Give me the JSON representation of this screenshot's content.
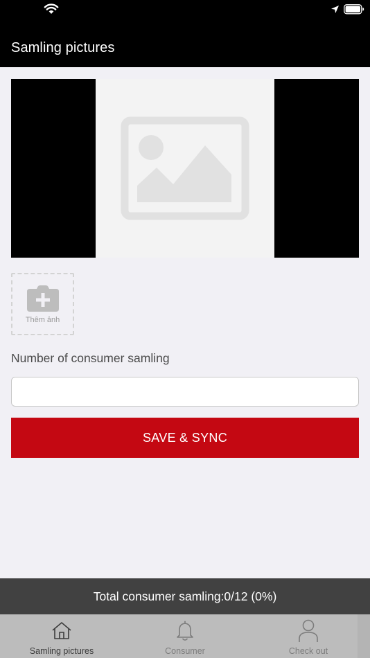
{
  "header": {
    "title": "Samling pictures"
  },
  "photo": {
    "add_label": "Thêm ảnh"
  },
  "form": {
    "consumer_label": "Number of consumer samling",
    "consumer_value": "",
    "save_label": "SAVE & SYNC"
  },
  "summary": {
    "text": "Total consumer samling:0/12 (0%)",
    "current": 0,
    "total": 12,
    "percent": 0
  },
  "tabs": [
    {
      "label": "Samling pictures",
      "icon": "home-icon",
      "active": true
    },
    {
      "label": "Consumer",
      "icon": "bell-icon",
      "active": false
    },
    {
      "label": "Check out",
      "icon": "person-icon",
      "active": false
    }
  ],
  "colors": {
    "header_bg": "#000000",
    "accent_red": "#c40812",
    "summary_bg": "#414141",
    "tabbar_bg": "#bcbcbc",
    "page_bg": "#f1f0f5"
  }
}
